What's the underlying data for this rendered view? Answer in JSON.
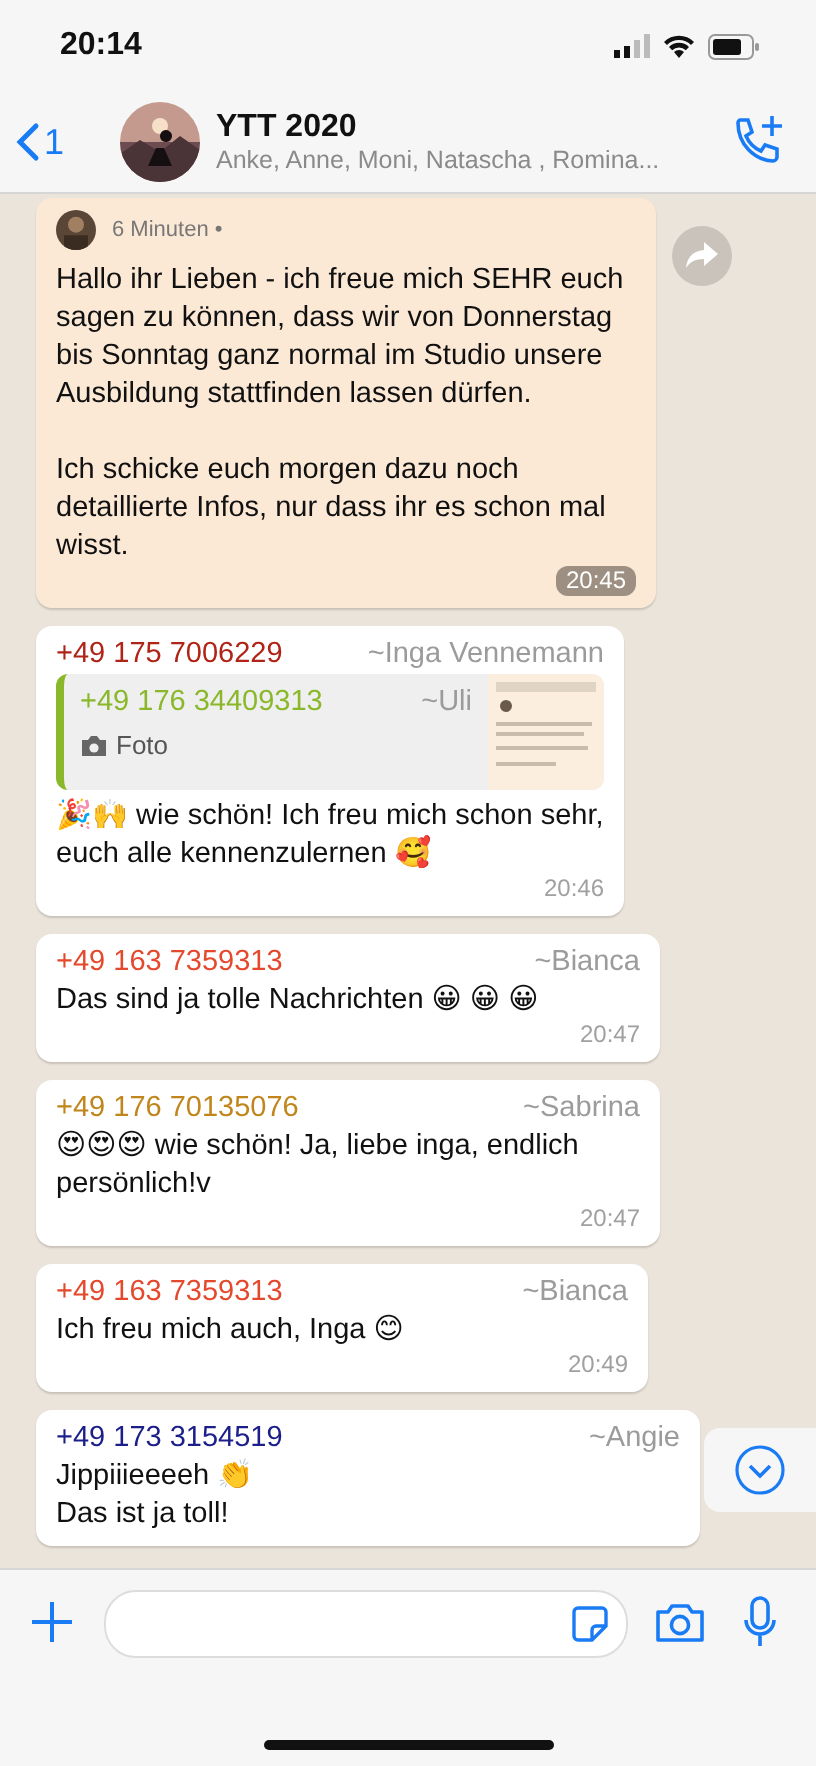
{
  "status_bar": {
    "time": "20:14"
  },
  "header": {
    "back_count": "1",
    "title": "YTT 2020",
    "members": "Anke, Anne, Moni, Natascha , Romina..."
  },
  "messages": [
    {
      "kind": "forwarded_image",
      "meta": "6 Minuten •",
      "text": "Hallo ihr Lieben - ich freue mich SEHR euch sagen zu können, dass wir von Donnerstag bis Sonntag ganz normal im Studio unsere Ausbildung stattfinden lassen dürfen.\n\nIch schicke euch morgen dazu noch detaillierte Infos, nur dass ihr es schon mal wisst.",
      "time": "20:45"
    },
    {
      "kind": "reply",
      "sender": "+49 175 7006229",
      "name": "~Inga Vennemann",
      "color": "#b02418",
      "quote": {
        "sender": "+49 176 34409313",
        "name": "~Uli",
        "color": "#8ab82a",
        "label": "Foto"
      },
      "text": "🎉🙌 wie schön! Ich freu mich schon sehr, euch alle kennenzulernen 🥰",
      "time": "20:46"
    },
    {
      "kind": "text",
      "sender": "+49 163 7359313",
      "name": "~Bianca",
      "color": "#e5492d",
      "text": "Das sind ja tolle Nachrichten 😀 😀 😀",
      "time": "20:47"
    },
    {
      "kind": "text",
      "sender": "+49 176 70135076",
      "name": "~Sabrina",
      "color": "#c0861c",
      "text": "😍😍😍 wie schön! Ja, liebe inga, endlich persönlich!v",
      "time": "20:47"
    },
    {
      "kind": "text",
      "sender": "+49 163 7359313",
      "name": "~Bianca",
      "color": "#e5492d",
      "text": "Ich freu mich auch, Inga 😊",
      "time": "20:49"
    },
    {
      "kind": "text",
      "sender": "+49 173 3154519",
      "name": "~Angie",
      "color": "#1c1f8a",
      "text": "Jippiiieeeeh 👏\nDas ist ja toll!"
    }
  ]
}
